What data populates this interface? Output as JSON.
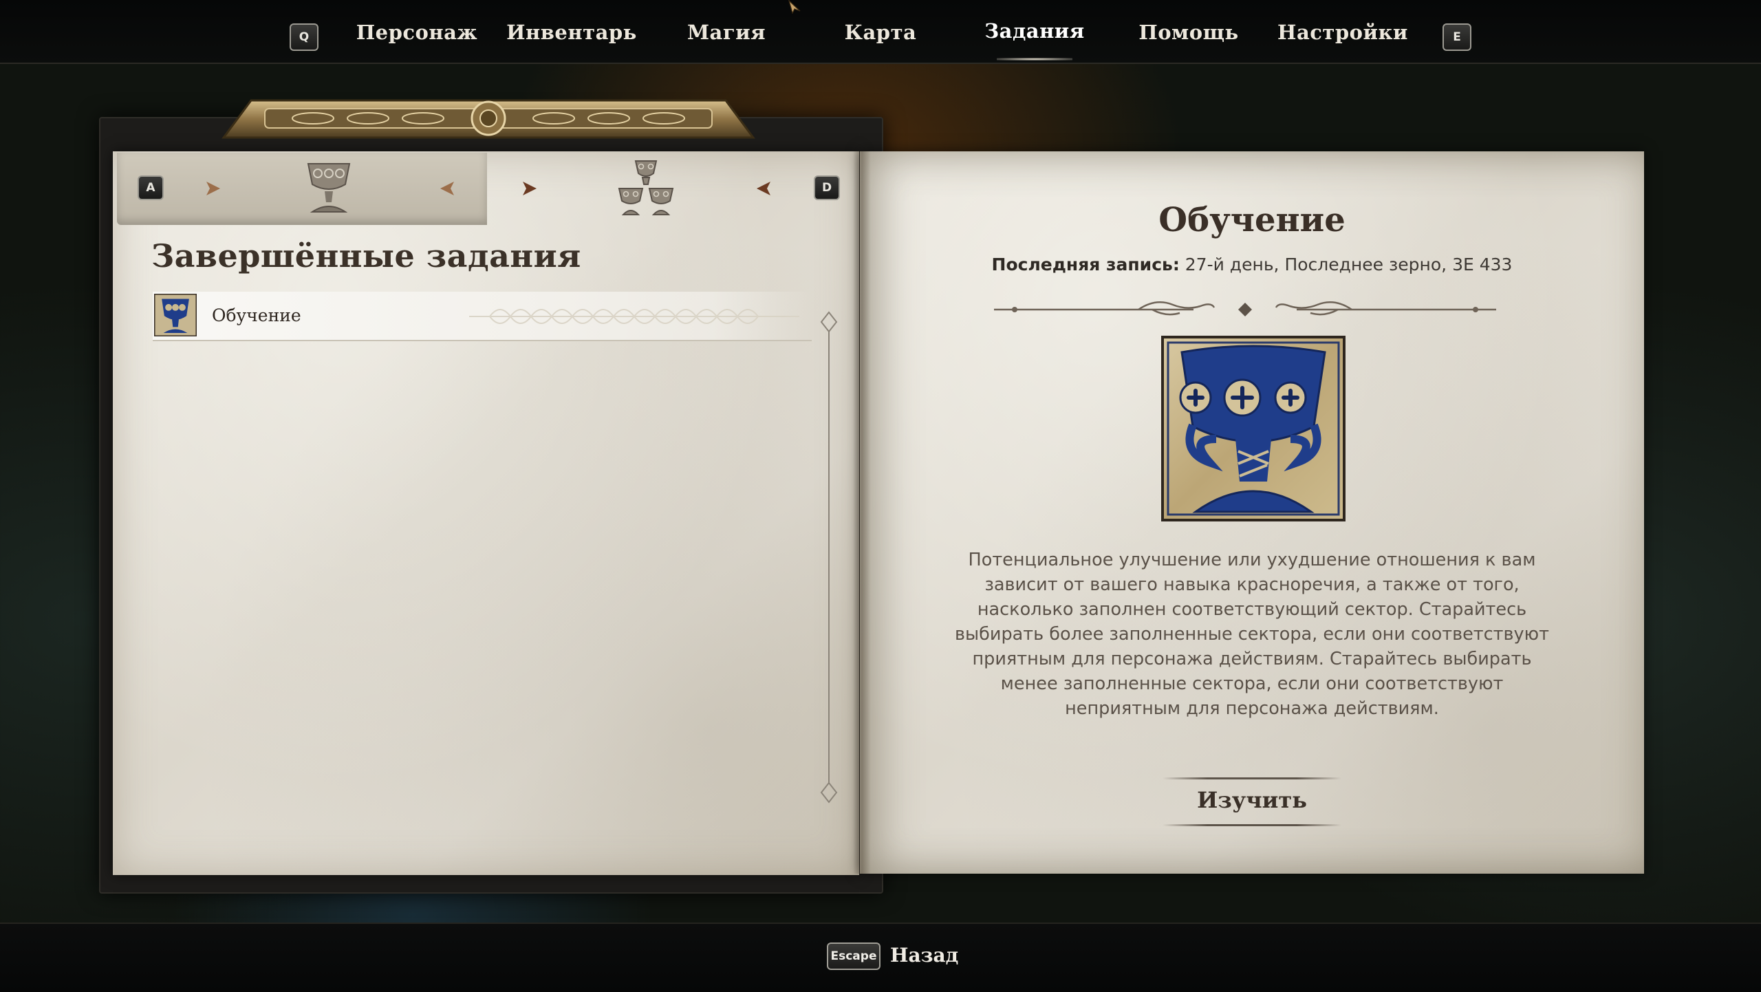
{
  "nav": {
    "left_key": "Q",
    "right_key": "E",
    "items": [
      {
        "label": "Персонаж",
        "active": false
      },
      {
        "label": "Инвентарь",
        "active": false
      },
      {
        "label": "Магия",
        "active": false
      },
      {
        "label": "Карта",
        "active": false
      },
      {
        "label": "Задания",
        "active": true
      },
      {
        "label": "Помощь",
        "active": false
      },
      {
        "label": "Настройки",
        "active": false
      }
    ]
  },
  "journal": {
    "tabs": {
      "left_key": "A",
      "right_key": "D",
      "active_tab_icon": "single-chalice-icon",
      "inactive_tab_icon": "stacked-chalices-icon"
    },
    "section_title": "Завершённые задания",
    "quests": [
      {
        "label": "Обучение",
        "icon": "blue-chalice-icon",
        "selected": true
      }
    ]
  },
  "detail": {
    "title": "Обучение",
    "last_entry_label": "Последняя запись:",
    "last_entry_value": "27-й день, Последнее зерно, 3Е 433",
    "image_icon": "blue-chalice-icon",
    "description": "Потенциальное улучшение или ухудшение отношения к вам зависит от вашего навыка красноречия, а также от того, насколько заполнен соответствующий сектор. Старайтесь выбирать более заполненные сектора, если они соответствуют приятным для персонажа действиям. Старайтесь выбирать менее заполненные сектора, если они соответствуют неприятным для персонажа действиям.",
    "study_button": "Изучить"
  },
  "footer": {
    "back_key": "Escape",
    "back_label": "Назад"
  },
  "colors": {
    "chalice_blue": "#1f3d8a",
    "chalice_gold": "#c9b98f",
    "paper": "#e4e0d7",
    "ink": "#3a2f27"
  }
}
